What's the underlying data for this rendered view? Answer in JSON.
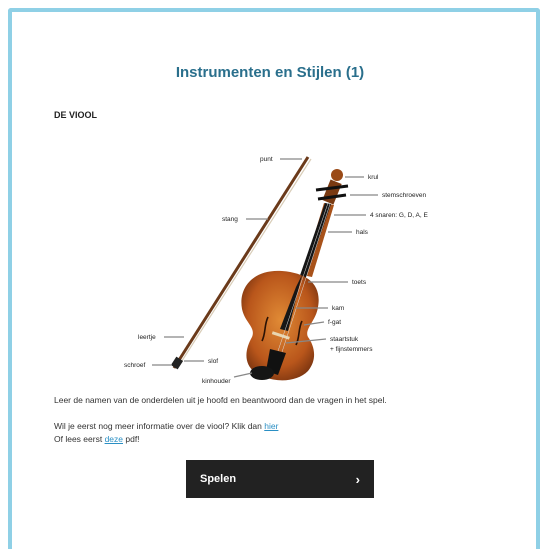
{
  "page": {
    "title": "Instrumenten en Stijlen (1)",
    "subtitle": "DE VIOOL"
  },
  "diagram": {
    "labels": {
      "punt": "punt",
      "krul": "krul",
      "stemschroeven": "stemschroeven",
      "snaren": "4 snaren: G, D, A, E",
      "hals": "hals",
      "stang": "stang",
      "toets": "toets",
      "kam": "kam",
      "fgat": "f-gat",
      "staartstuk": "staartstuk",
      "fijnstemmers": "+ fijnstemmers",
      "leertje": "leertje",
      "schroef": "schroef",
      "slof": "slof",
      "kinhouder": "kinhouder"
    }
  },
  "text": {
    "instruction": "Leer de namen van de onderdelen uit je hoofd en beantwoord dan de vragen in het spel.",
    "info_prefix": "Wil je eerst nog meer informatie over de viool? Klik dan ",
    "info_link": "hier",
    "pdf_prefix": "Of lees eerst ",
    "pdf_link": "deze",
    "pdf_suffix": " pdf!"
  },
  "button": {
    "label": "Spelen",
    "icon": "chevron-right-icon"
  },
  "colors": {
    "border": "#8fd0e6",
    "title": "#2a6f8c",
    "link": "#2a8fc4",
    "button": "#222222",
    "violin_body": "#c0661f"
  }
}
